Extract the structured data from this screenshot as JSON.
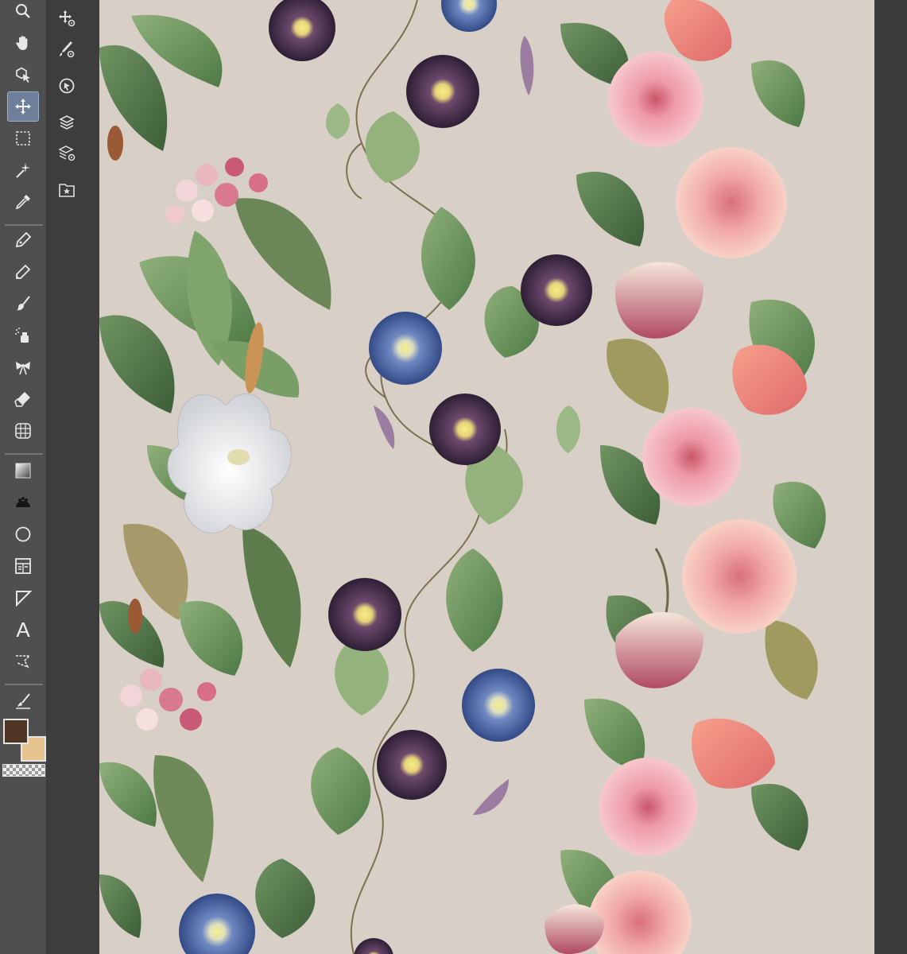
{
  "tools": [
    {
      "name": "zoom-tool",
      "icon": "magnifier-icon"
    },
    {
      "name": "hand-tool",
      "icon": "hand-icon"
    },
    {
      "name": "object-select-tool",
      "icon": "operation-cursor-icon"
    },
    {
      "name": "move-layer-tool",
      "icon": "move-arrows-icon",
      "active": true
    },
    {
      "name": "rect-selection-tool",
      "icon": "marquee-icon"
    },
    {
      "name": "auto-select-tool",
      "icon": "magic-wand-icon"
    },
    {
      "name": "eyedropper-tool",
      "icon": "eyedropper-icon"
    },
    {
      "name": "pen-tool",
      "icon": "pen-nib-icon"
    },
    {
      "name": "pencil-tool",
      "icon": "pencil-icon"
    },
    {
      "name": "brush-tool",
      "icon": "brush-icon"
    },
    {
      "name": "airbrush-tool",
      "icon": "airbrush-icon"
    },
    {
      "name": "decoration-tool",
      "icon": "ribbon-icon"
    },
    {
      "name": "eraser-tool",
      "icon": "eraser-icon"
    },
    {
      "name": "blend-tool",
      "icon": "blend-grid-icon"
    },
    {
      "name": "gradient-tool",
      "icon": "gradient-icon"
    },
    {
      "name": "fill-tool",
      "icon": "fill-blob-icon"
    },
    {
      "name": "figure-tool",
      "icon": "circle-icon"
    },
    {
      "name": "frame-border-tool",
      "icon": "frame-icon"
    },
    {
      "name": "ruler-tool",
      "icon": "ruler-icon"
    },
    {
      "name": "text-tool",
      "icon": "text-icon",
      "label": "A"
    },
    {
      "name": "balloon-tool",
      "icon": "balloon-icon"
    },
    {
      "name": "correct-line-tool",
      "icon": "line-brush-icon"
    }
  ],
  "subtools": [
    {
      "name": "transform-subtool",
      "icon": "move-gear-icon"
    },
    {
      "name": "brush-setting-subtool",
      "icon": "brush-gear-icon"
    },
    {
      "name": "object-subtool",
      "icon": "target-icon"
    },
    {
      "name": "layer-subtool",
      "icon": "layers-icon"
    },
    {
      "name": "layer-setting-subtool",
      "icon": "layers-gear-icon"
    },
    {
      "name": "material-subtool",
      "icon": "star-folder-icon"
    }
  ],
  "colors": {
    "main": "#4f3523",
    "sub": "#e6c28d",
    "canvas_bg": "#d8cfc6",
    "toolbar_bg": "#4f4f4f",
    "active_tool": "#6e7f99"
  },
  "canvas": {
    "description_icon": "botanical-floral-pattern-icon"
  }
}
